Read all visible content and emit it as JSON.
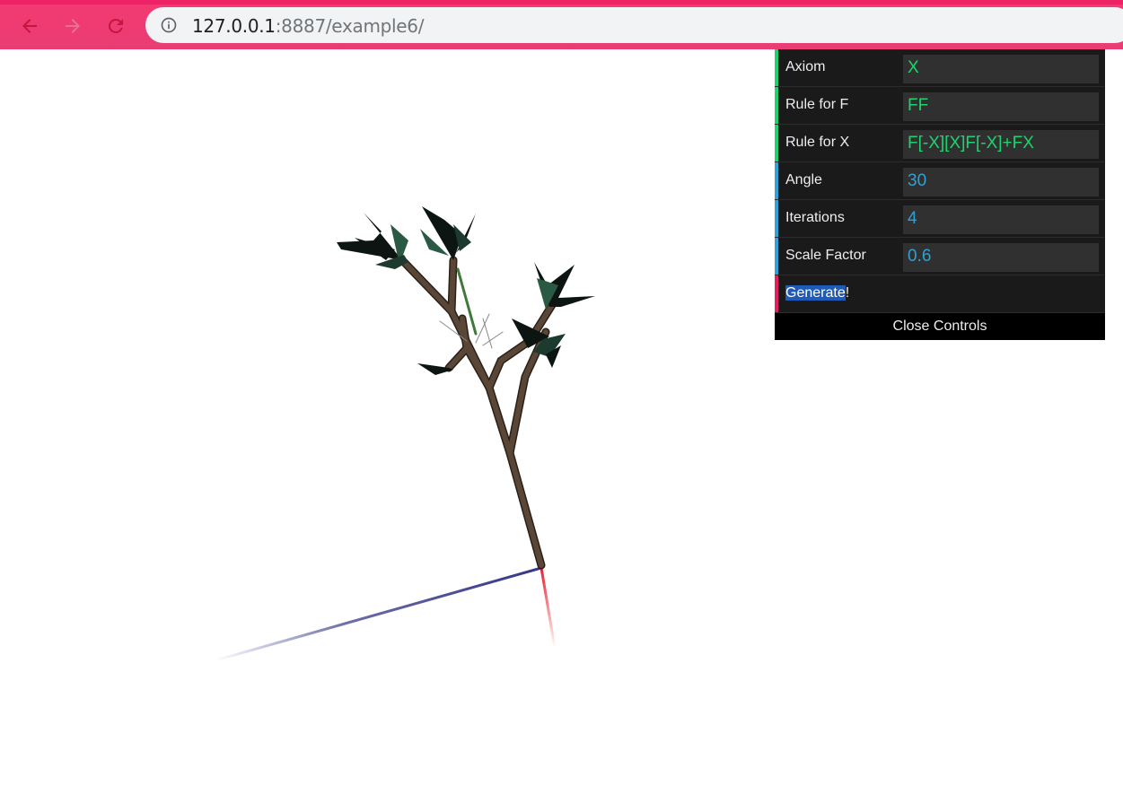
{
  "browser": {
    "url_host": "127.0.0.1",
    "url_rest": ":8887/example6/"
  },
  "controls": {
    "rows": [
      {
        "label": "Axiom",
        "value": "X",
        "kind": "string"
      },
      {
        "label": "Rule for F",
        "value": "FF",
        "kind": "string"
      },
      {
        "label": "Rule for X",
        "value": "F[-X][X]F[-X]+FX",
        "kind": "string"
      },
      {
        "label": "Angle",
        "value": "30",
        "kind": "number"
      },
      {
        "label": "Iterations",
        "value": "4",
        "kind": "number"
      },
      {
        "label": "Scale Factor",
        "value": "0.6",
        "kind": "number"
      }
    ],
    "generate_selected": "Generate",
    "generate_rest": "!",
    "close_label": "Close Controls"
  },
  "colors": {
    "chrome": "#f23a72",
    "string_accent": "#1ed36f",
    "number_accent": "#2fa1d6",
    "function_accent": "#e61d5f",
    "trunk": "#4a3a2c",
    "leaf_dark": "#0d1512",
    "leaf_green": "#2b5a44",
    "axis_x": "#e8323c",
    "axis_z": "#3d3f8c"
  },
  "icons": {
    "back": "arrow-left-icon",
    "forward": "arrow-right-icon",
    "reload": "reload-icon",
    "info": "info-icon"
  }
}
